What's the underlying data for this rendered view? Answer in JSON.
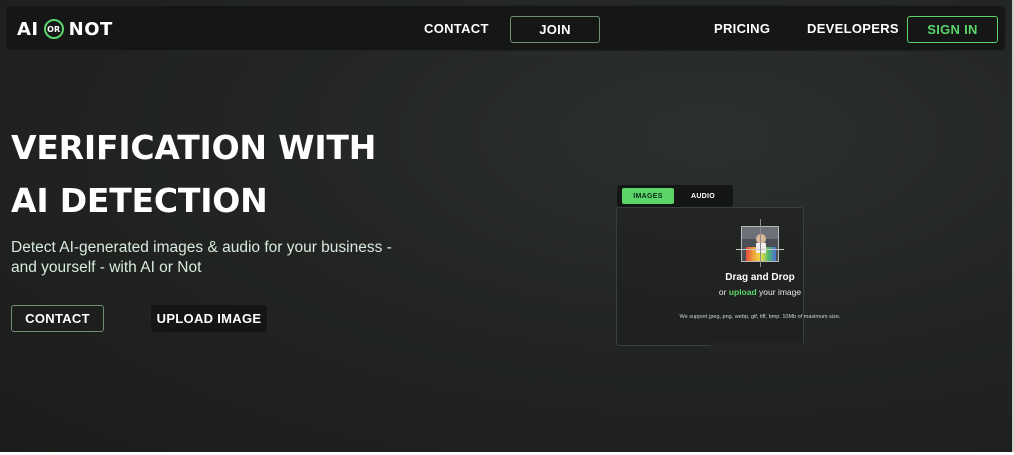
{
  "nav": {
    "logo_left": "AI",
    "logo_mid": "OR",
    "logo_right": "NOT",
    "contact": "CONTACT",
    "join": "JOIN",
    "pricing": "PRICING",
    "developers": "DEVELOPERS",
    "sign_in": "SIGN IN"
  },
  "hero": {
    "title_line1": "VERIFICATION WITH",
    "title_line2": "AI DETECTION",
    "subtitle": "Detect AI-generated images & audio for your business - and yourself - with AI or Not",
    "contact_button": "CONTACT",
    "upload_button": "UPLOAD IMAGE"
  },
  "uploader": {
    "tabs": [
      "IMAGES",
      "AUDIO"
    ],
    "active_tab": "IMAGES",
    "title": "Drag and Drop",
    "line_prefix": "or",
    "line_link": "upload",
    "line_suffix": "your image",
    "note": "We support jpeg, png, webp, gif, tiff, bmp. 10Mb of maximum size."
  },
  "colors": {
    "accent": "#5bd46a",
    "background": "#222523",
    "nav_background": "#151716"
  }
}
